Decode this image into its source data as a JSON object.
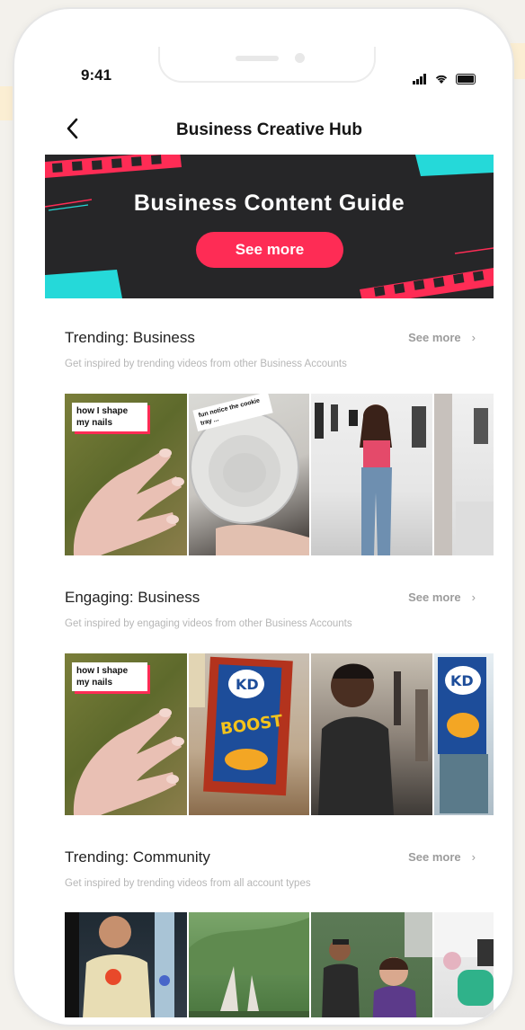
{
  "status_bar": {
    "time": "9:41"
  },
  "nav": {
    "title": "Business Creative Hub"
  },
  "banner": {
    "title": "Business Content Guide",
    "button_label": "See more"
  },
  "sections": [
    {
      "title": "Trending: Business",
      "subtitle": "Get inspired by trending videos from other Business Accounts",
      "see_more": "See more",
      "thumb_captions": [
        "how I shape\nmy nails",
        "fun notice the cookie tray ...",
        "",
        ""
      ]
    },
    {
      "title": "Engaging: Business",
      "subtitle": "Get inspired by engaging videos from other Business Accounts",
      "see_more": "See more",
      "thumb_captions": [
        "how I shape\nmy nails",
        "",
        "",
        ""
      ]
    },
    {
      "title": "Trending: Community",
      "subtitle": "Get inspired by trending videos from all account types",
      "see_more": "See more",
      "thumb_captions": [
        "",
        "",
        "",
        ""
      ]
    }
  ],
  "brand": {
    "pink": "#fe2c55",
    "cyan": "#25d9d9",
    "dark": "#262628"
  }
}
